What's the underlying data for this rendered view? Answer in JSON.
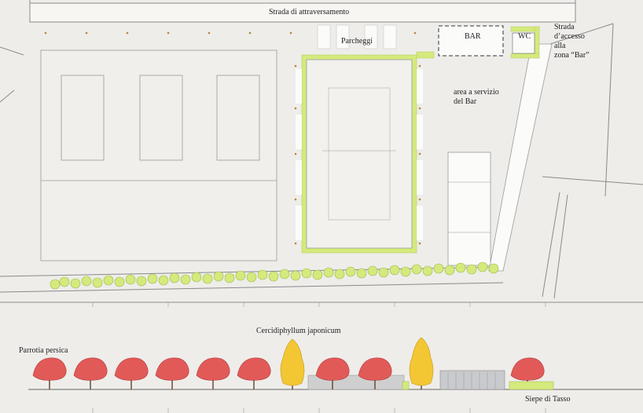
{
  "plan": {
    "road_label": "Strada di attraversamento",
    "parking_label": "Parcheggi",
    "bar_label": "BAR",
    "wc_label": "WC",
    "access_road_lines": [
      "Strada",
      "d’accesso",
      "alla",
      "zona “Bar”"
    ],
    "bar_area_lines": [
      "area a servizio",
      "del Bar"
    ]
  },
  "elevation": {
    "tree_left_label": "Parrotia persica",
    "tree_mid_label": "Cercidiphyllum japonicum",
    "hedge_label": "Siepe di Tasso"
  },
  "colors": {
    "background": "#eeedea",
    "paper_light": "#f4f3f0",
    "hedge_green": "#d4ea7c",
    "tree_red": "#e15a58",
    "tree_yellow": "#f3c634",
    "line": "#777777"
  }
}
